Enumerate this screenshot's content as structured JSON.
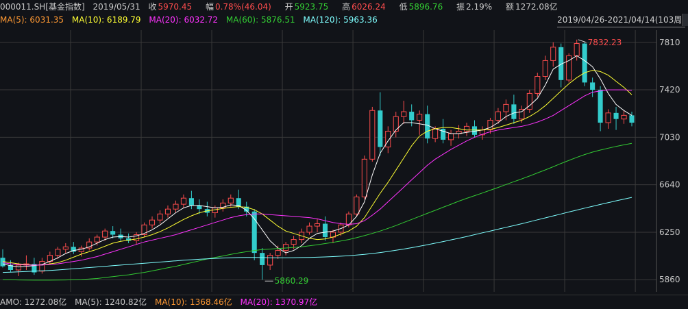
{
  "header": {
    "code": "000011.SH[基金指数]",
    "date": "2019/05/31",
    "close_label": "收",
    "close_value": "5970.45",
    "change_label": "幅",
    "change_value": "0.78%(46.04)",
    "open_label": "开",
    "open_value": "5923.75",
    "high_label": "高",
    "high_value": "6026.24",
    "low_label": "低",
    "low_value": "5896.76",
    "amplitude_label": "振",
    "amplitude_value": "2.19%",
    "amount_label": "额",
    "amount_value": "1272.08亿"
  },
  "ma_legend": {
    "ma5": "MA(5): 6031.35",
    "ma10": "MA(10): 6189.79",
    "ma20": "MA(20): 6032.72",
    "ma60": "MA(60): 5876.51",
    "ma120": "MA(120): 5963.36"
  },
  "range_label": "2019/04/26-2021/04/14(103周)",
  "footer": {
    "amo": "AMO: 1272.08亿",
    "ma5": "MA(5): 1240.82亿",
    "ma10": "MA(10): 1368.46亿",
    "ma20": "MA(20): 1370.97亿"
  },
  "colors": {
    "up": "#ff4d4d",
    "down": "#33cccc",
    "ma5": "#ffffff",
    "ma10": "#ffff33",
    "ma20": "#ff33ff",
    "ma60": "#33cc33",
    "ma120": "#7fffff",
    "grid": "#3a3a3a",
    "axis_text": "#c8c8c8",
    "high_mark": "#ff4d4d",
    "low_mark": "#33cc33"
  },
  "chart_data": {
    "type": "candlestick",
    "ylim": [
      5760,
      7910
    ],
    "yticks": [
      5860,
      6250,
      6640,
      7030,
      7420,
      7810
    ],
    "annotations": {
      "high": "7832.23",
      "low": "5860.29"
    },
    "candles": [
      {
        "o": 6040,
        "h": 6110,
        "l": 5960,
        "c": 5970
      },
      {
        "o": 5980,
        "h": 6020,
        "l": 5920,
        "c": 5940
      },
      {
        "o": 5940,
        "h": 6000,
        "l": 5890,
        "c": 5980
      },
      {
        "o": 5980,
        "h": 6060,
        "l": 5940,
        "c": 5990
      },
      {
        "o": 5990,
        "h": 6040,
        "l": 5900,
        "c": 5920
      },
      {
        "o": 5930,
        "h": 6040,
        "l": 5910,
        "c": 6010
      },
      {
        "o": 6010,
        "h": 6090,
        "l": 5990,
        "c": 6060
      },
      {
        "o": 6060,
        "h": 6130,
        "l": 6030,
        "c": 6110
      },
      {
        "o": 6110,
        "h": 6160,
        "l": 6080,
        "c": 6130
      },
      {
        "o": 6130,
        "h": 6170,
        "l": 6070,
        "c": 6090
      },
      {
        "o": 6090,
        "h": 6140,
        "l": 6050,
        "c": 6120
      },
      {
        "o": 6120,
        "h": 6200,
        "l": 6100,
        "c": 6170
      },
      {
        "o": 6170,
        "h": 6230,
        "l": 6140,
        "c": 6210
      },
      {
        "o": 6210,
        "h": 6280,
        "l": 6180,
        "c": 6260
      },
      {
        "o": 6260,
        "h": 6300,
        "l": 6200,
        "c": 6230
      },
      {
        "o": 6230,
        "h": 6280,
        "l": 6180,
        "c": 6200
      },
      {
        "o": 6200,
        "h": 6240,
        "l": 6160,
        "c": 6180
      },
      {
        "o": 6180,
        "h": 6250,
        "l": 6150,
        "c": 6230
      },
      {
        "o": 6230,
        "h": 6330,
        "l": 6210,
        "c": 6310
      },
      {
        "o": 6310,
        "h": 6380,
        "l": 6280,
        "c": 6350
      },
      {
        "o": 6350,
        "h": 6430,
        "l": 6320,
        "c": 6400
      },
      {
        "o": 6400,
        "h": 6470,
        "l": 6370,
        "c": 6440
      },
      {
        "o": 6440,
        "h": 6510,
        "l": 6410,
        "c": 6480
      },
      {
        "o": 6480,
        "h": 6560,
        "l": 6450,
        "c": 6530
      },
      {
        "o": 6530,
        "h": 6590,
        "l": 6440,
        "c": 6470
      },
      {
        "o": 6470,
        "h": 6520,
        "l": 6400,
        "c": 6440
      },
      {
        "o": 6440,
        "h": 6500,
        "l": 6380,
        "c": 6410
      },
      {
        "o": 6410,
        "h": 6470,
        "l": 6370,
        "c": 6450
      },
      {
        "o": 6450,
        "h": 6520,
        "l": 6420,
        "c": 6490
      },
      {
        "o": 6490,
        "h": 6560,
        "l": 6460,
        "c": 6530
      },
      {
        "o": 6530,
        "h": 6600,
        "l": 6440,
        "c": 6460
      },
      {
        "o": 6460,
        "h": 6500,
        "l": 6380,
        "c": 6420
      },
      {
        "o": 6420,
        "h": 6440,
        "l": 6020,
        "c": 6080
      },
      {
        "o": 6080,
        "h": 6120,
        "l": 5860,
        "c": 5980
      },
      {
        "o": 5980,
        "h": 6080,
        "l": 5940,
        "c": 6060
      },
      {
        "o": 6060,
        "h": 6140,
        "l": 6030,
        "c": 6100
      },
      {
        "o": 6100,
        "h": 6170,
        "l": 6060,
        "c": 6150
      },
      {
        "o": 6150,
        "h": 6220,
        "l": 6110,
        "c": 6190
      },
      {
        "o": 6190,
        "h": 6280,
        "l": 6160,
        "c": 6250
      },
      {
        "o": 6250,
        "h": 6330,
        "l": 6230,
        "c": 6300
      },
      {
        "o": 6300,
        "h": 6360,
        "l": 6250,
        "c": 6320
      },
      {
        "o": 6320,
        "h": 6380,
        "l": 6180,
        "c": 6210
      },
      {
        "o": 6210,
        "h": 6270,
        "l": 6160,
        "c": 6250
      },
      {
        "o": 6250,
        "h": 6330,
        "l": 6220,
        "c": 6310
      },
      {
        "o": 6310,
        "h": 6420,
        "l": 6290,
        "c": 6400
      },
      {
        "o": 6400,
        "h": 6560,
        "l": 6380,
        "c": 6540
      },
      {
        "o": 6540,
        "h": 6880,
        "l": 6520,
        "c": 6850
      },
      {
        "o": 6850,
        "h": 7280,
        "l": 6830,
        "c": 7250
      },
      {
        "o": 7250,
        "h": 7400,
        "l": 6880,
        "c": 6950
      },
      {
        "o": 6950,
        "h": 7120,
        "l": 6900,
        "c": 7080
      },
      {
        "o": 7080,
        "h": 7240,
        "l": 7030,
        "c": 7200
      },
      {
        "o": 7200,
        "h": 7330,
        "l": 7140,
        "c": 7240
      },
      {
        "o": 7240,
        "h": 7300,
        "l": 7120,
        "c": 7170
      },
      {
        "o": 7170,
        "h": 7250,
        "l": 7050,
        "c": 7220
      },
      {
        "o": 7220,
        "h": 7290,
        "l": 6980,
        "c": 7020
      },
      {
        "o": 7020,
        "h": 7120,
        "l": 6990,
        "c": 7100
      },
      {
        "o": 7100,
        "h": 7180,
        "l": 6980,
        "c": 7010
      },
      {
        "o": 7010,
        "h": 7090,
        "l": 6960,
        "c": 7060
      },
      {
        "o": 7060,
        "h": 7130,
        "l": 7020,
        "c": 7080
      },
      {
        "o": 7080,
        "h": 7150,
        "l": 7040,
        "c": 7120
      },
      {
        "o": 7120,
        "h": 7170,
        "l": 7030,
        "c": 7050
      },
      {
        "o": 7050,
        "h": 7120,
        "l": 7010,
        "c": 7090
      },
      {
        "o": 7090,
        "h": 7190,
        "l": 7060,
        "c": 7170
      },
      {
        "o": 7170,
        "h": 7270,
        "l": 7140,
        "c": 7240
      },
      {
        "o": 7240,
        "h": 7340,
        "l": 7170,
        "c": 7300
      },
      {
        "o": 7300,
        "h": 7380,
        "l": 7140,
        "c": 7180
      },
      {
        "o": 7180,
        "h": 7290,
        "l": 7150,
        "c": 7260
      },
      {
        "o": 7260,
        "h": 7420,
        "l": 7230,
        "c": 7390
      },
      {
        "o": 7390,
        "h": 7560,
        "l": 7360,
        "c": 7530
      },
      {
        "o": 7530,
        "h": 7700,
        "l": 7500,
        "c": 7660
      },
      {
        "o": 7660,
        "h": 7810,
        "l": 7610,
        "c": 7770
      },
      {
        "o": 7770,
        "h": 7800,
        "l": 7440,
        "c": 7500
      },
      {
        "o": 7500,
        "h": 7720,
        "l": 7480,
        "c": 7700
      },
      {
        "o": 7700,
        "h": 7832,
        "l": 7660,
        "c": 7800
      },
      {
        "o": 7800,
        "h": 7810,
        "l": 7450,
        "c": 7480
      },
      {
        "o": 7480,
        "h": 7520,
        "l": 7360,
        "c": 7420
      },
      {
        "o": 7420,
        "h": 7450,
        "l": 7080,
        "c": 7150
      },
      {
        "o": 7150,
        "h": 7260,
        "l": 7100,
        "c": 7230
      },
      {
        "o": 7230,
        "h": 7280,
        "l": 7090,
        "c": 7180
      },
      {
        "o": 7180,
        "h": 7250,
        "l": 7140,
        "c": 7210
      },
      {
        "o": 7210,
        "h": 7240,
        "l": 7120,
        "c": 7150
      }
    ],
    "ma": {
      "ma5": [
        5990,
        5975,
        5965,
        5970,
        5975,
        5985,
        6010,
        6040,
        6075,
        6100,
        6110,
        6130,
        6160,
        6190,
        6210,
        6215,
        6210,
        6220,
        6240,
        6270,
        6310,
        6360,
        6410,
        6450,
        6470,
        6470,
        6460,
        6450,
        6455,
        6475,
        6470,
        6430,
        6360,
        6270,
        6180,
        6120,
        6080,
        6100,
        6140,
        6200,
        6240,
        6250,
        6260,
        6280,
        6310,
        6380,
        6500,
        6720,
        6900,
        7000,
        7090,
        7150,
        7150,
        7140,
        7130,
        7100,
        7080,
        7060,
        7060,
        7070,
        7080,
        7090,
        7110,
        7150,
        7200,
        7230,
        7240,
        7290,
        7350,
        7460,
        7590,
        7630,
        7660,
        7700,
        7660,
        7610,
        7510,
        7390,
        7300,
        7250,
        7210
      ],
      "ma10": [
        6010,
        6000,
        5990,
        5985,
        5980,
        5980,
        5990,
        6000,
        6020,
        6045,
        6070,
        6090,
        6110,
        6135,
        6160,
        6175,
        6185,
        6195,
        6210,
        6230,
        6255,
        6285,
        6320,
        6355,
        6385,
        6410,
        6425,
        6435,
        6445,
        6455,
        6460,
        6455,
        6435,
        6400,
        6350,
        6300,
        6260,
        6240,
        6220,
        6200,
        6190,
        6195,
        6210,
        6235,
        6260,
        6300,
        6370,
        6470,
        6570,
        6660,
        6760,
        6860,
        6960,
        7040,
        7080,
        7100,
        7110,
        7110,
        7100,
        7090,
        7090,
        7090,
        7095,
        7110,
        7130,
        7150,
        7170,
        7200,
        7240,
        7290,
        7350,
        7410,
        7470,
        7520,
        7560,
        7580,
        7570,
        7540,
        7490,
        7440,
        7380
      ],
      "ma20": [
        6000,
        5990,
        5985,
        5980,
        5980,
        5980,
        5985,
        5990,
        6000,
        6010,
        6020,
        6035,
        6050,
        6070,
        6090,
        6110,
        6130,
        6150,
        6170,
        6185,
        6200,
        6215,
        6230,
        6250,
        6270,
        6290,
        6310,
        6330,
        6350,
        6370,
        6385,
        6395,
        6400,
        6400,
        6395,
        6390,
        6385,
        6380,
        6375,
        6370,
        6360,
        6345,
        6330,
        6320,
        6315,
        6320,
        6345,
        6390,
        6440,
        6500,
        6560,
        6620,
        6680,
        6740,
        6800,
        6850,
        6890,
        6930,
        6965,
        7000,
        7030,
        7055,
        7075,
        7090,
        7100,
        7110,
        7120,
        7135,
        7155,
        7180,
        7210,
        7250,
        7290,
        7330,
        7370,
        7400,
        7410,
        7420,
        7420,
        7420,
        7415
      ],
      "ma60": [
        5860,
        5860,
        5858,
        5857,
        5856,
        5856,
        5856,
        5857,
        5858,
        5860,
        5862,
        5865,
        5870,
        5878,
        5885,
        5893,
        5900,
        5910,
        5920,
        5932,
        5945,
        5958,
        5970,
        5985,
        6000,
        6015,
        6030,
        6043,
        6055,
        6068,
        6080,
        6090,
        6100,
        6108,
        6112,
        6116,
        6120,
        6125,
        6130,
        6138,
        6147,
        6157,
        6167,
        6178,
        6190,
        6205,
        6222,
        6240,
        6260,
        6282,
        6305,
        6330,
        6355,
        6380,
        6405,
        6430,
        6455,
        6480,
        6505,
        6528,
        6550,
        6572,
        6595,
        6618,
        6642,
        6665,
        6688,
        6712,
        6737,
        6762,
        6788,
        6815,
        6840,
        6865,
        6888,
        6908,
        6925,
        6940,
        6955,
        6968,
        6980
      ],
      "ma120": [
        5920,
        5922,
        5925,
        5928,
        5930,
        5933,
        5936,
        5940,
        5945,
        5950,
        5955,
        5960,
        5965,
        5970,
        5975,
        5980,
        5985,
        5990,
        5995,
        6000,
        6005,
        6010,
        6015,
        6020,
        6024,
        6028,
        6032,
        6035,
        6038,
        6040,
        6042,
        6043,
        6043,
        6042,
        6040,
        6040,
        6040,
        6041,
        6042,
        6043,
        6045,
        6047,
        6050,
        6053,
        6057,
        6062,
        6068,
        6075,
        6083,
        6092,
        6102,
        6112,
        6123,
        6135,
        6147,
        6160,
        6173,
        6187,
        6200,
        6215,
        6230,
        6245,
        6260,
        6275,
        6290,
        6305,
        6320,
        6336,
        6352,
        6368,
        6384,
        6400,
        6416,
        6432,
        6448,
        6463,
        6478,
        6493,
        6508,
        6522,
        6536
      ]
    }
  }
}
